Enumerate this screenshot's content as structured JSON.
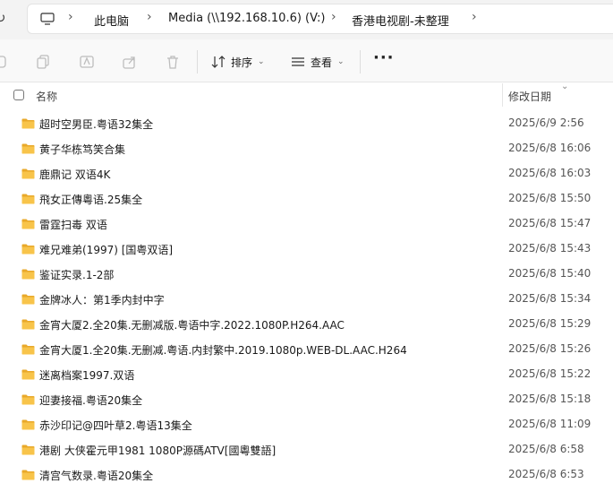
{
  "breadcrumb": {
    "items": [
      "此电脑",
      "Media (\\\\192.168.10.6) (V:)",
      "香港电视剧-未整理"
    ]
  },
  "toolbar": {
    "sort_label": "排序",
    "view_label": "查看",
    "more_label": "···"
  },
  "columns": {
    "name": "名称",
    "date": "修改日期"
  },
  "colors": {
    "folder": "#f8c44a",
    "folder_dark": "#e9a92a"
  },
  "files": [
    {
      "name": "超时空男臣.粤语32集全",
      "date": "2025/6/9 2:56"
    },
    {
      "name": "黄子华栋笃笑合集",
      "date": "2025/6/8 16:06"
    },
    {
      "name": "鹿鼎记 双语4K",
      "date": "2025/6/8 16:03"
    },
    {
      "name": "飛女正傳粵语.25集全",
      "date": "2025/6/8 15:50"
    },
    {
      "name": "雷霆扫毒 双语",
      "date": "2025/6/8 15:47"
    },
    {
      "name": "难兄难弟(1997) [国粤双语]",
      "date": "2025/6/8 15:43"
    },
    {
      "name": "鉴证实录.1-2部",
      "date": "2025/6/8 15:40"
    },
    {
      "name": "金牌冰人：第1季内封中字",
      "date": "2025/6/8 15:34"
    },
    {
      "name": "金宵大厦2.全20集.无删减版.粤语中字.2022.1080P.H264.AAC",
      "date": "2025/6/8 15:29"
    },
    {
      "name": "金宵大厦1.全20集.无删减.粤语.内封繁中.2019.1080p.WEB-DL.AAC.H264",
      "date": "2025/6/8 15:26"
    },
    {
      "name": "迷离档案1997.双语",
      "date": "2025/6/8 15:22"
    },
    {
      "name": "迎妻接福.粤语20集全",
      "date": "2025/6/8 15:18"
    },
    {
      "name": "赤沙印记@四叶草2.粤语13集全",
      "date": "2025/6/8 11:09"
    },
    {
      "name": "港剧 大侠霍元甲1981 1080P源碼ATV[國粵雙語]",
      "date": "2025/6/8 6:58"
    },
    {
      "name": "清宫气数录.粤语20集全",
      "date": "2025/6/8 6:53"
    }
  ]
}
